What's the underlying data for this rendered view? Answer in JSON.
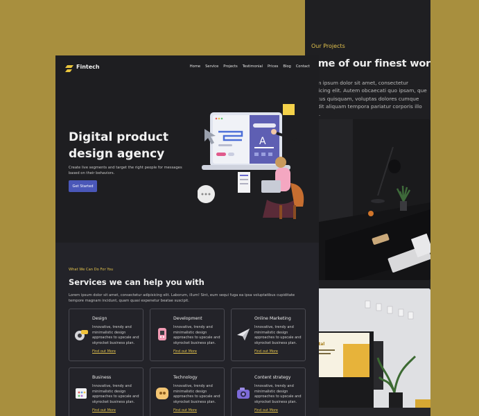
{
  "projects": {
    "eyebrow": "Our Projects",
    "title": "ome of our finest work",
    "description": "rem ipsum dolor sit amet, consectetur ipsicing elit. Autem obcaecati quo ipsam, que natus quisquam, voluptas dolores cumque bedit aliquam tempora pariatur corporis illo vel."
  },
  "header": {
    "brand": "Fintech",
    "nav": [
      "Home",
      "Service",
      "Projects",
      "Testimonial",
      "Prices",
      "Blog",
      "Contact"
    ]
  },
  "hero": {
    "title": "Digital product design agency",
    "description": "Create live segments and target the right people for messages based on their behaviors.",
    "cta": "Get Started"
  },
  "services": {
    "eyebrow": "What We Can Do For You",
    "title": "Services we can help you with",
    "description": "Lorem ipsum dolor sit amet, consectetur adipisicing elit. Laborum, illum! Sint, eum sequi fuga ea ipsa voluptatibus cupiditate tempore magnam incidunt, quam quasi expenetur beatae suscipit.",
    "cards": [
      {
        "title": "Design",
        "text": "Innovative, trendy and minimalistic design approaches to upscale and skyrocket business plan.",
        "link": "Find out More",
        "icon": "wrench-lock-icon"
      },
      {
        "title": "Development",
        "text": "Innovative, trendy and minimalistic design approaches to upscale and skyrocket business plan.",
        "link": "Find out More",
        "icon": "server-icon"
      },
      {
        "title": "Online Marketing",
        "text": "Innovative, trendy and minimalistic design approaches to upscale and skyrocket business plan.",
        "link": "Find out More",
        "icon": "paper-plane-icon"
      },
      {
        "title": "Business",
        "text": "Innovative, trendy and minimalistic design approaches to upscale and skyrocket business plan.",
        "link": "Find out More",
        "icon": "calendar-icon"
      },
      {
        "title": "Technology",
        "text": "Innovative, trendy and minimalistic design approaches to upscale and skyrocket business plan.",
        "link": "Find out More",
        "icon": "chip-icon"
      },
      {
        "title": "Content strategy",
        "text": "Innovative, trendy and minimalistic design approaches to upscale and skyrocket business plan.",
        "link": "Find out More",
        "icon": "camera-icon"
      }
    ]
  },
  "colors": {
    "background": "#a88f3e",
    "accent": "#e2c24d",
    "button": "#4a57b8"
  }
}
